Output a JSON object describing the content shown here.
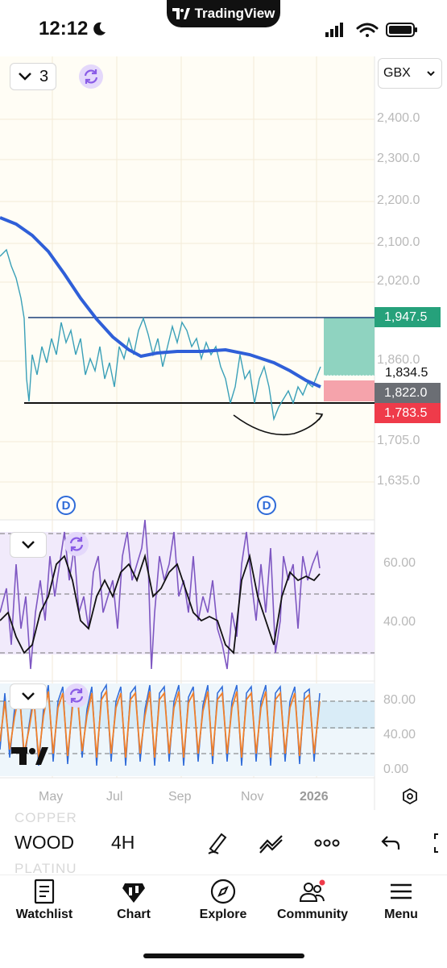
{
  "status_bar": {
    "time": "12:12",
    "app_pill": "TradingView"
  },
  "chart_toolbar": {
    "layout_count": "3",
    "currency": "GBX"
  },
  "price_axis": [
    "2,400.0",
    "2,300.0",
    "2,200.0",
    "2,100.0",
    "2,020.0",
    "1,860.0",
    "1,705.0",
    "1,635.0"
  ],
  "price_tags": {
    "target": {
      "value": "1,947.5",
      "color": "#26a17b"
    },
    "current": {
      "value": "1,834.5"
    },
    "last": {
      "value": "1,822.0",
      "color": "#6b6e74"
    },
    "stop": {
      "value": "1,783.5",
      "color": "#ef3b4a"
    }
  },
  "dividend_marker": "D",
  "rsi_axis": [
    "60.00",
    "40.00"
  ],
  "stoch_axis": [
    "80.00",
    "40.00",
    "0.00"
  ],
  "time_axis": [
    "May",
    "Jul",
    "Sep",
    "Nov",
    "2026"
  ],
  "symbol_bar": {
    "symbol": "WOOD",
    "interval": "4H",
    "ghost_above": "COPPER",
    "ghost_below": "PLATINU"
  },
  "nav": [
    {
      "label": "Watchlist",
      "icon": "watchlist-icon"
    },
    {
      "label": "Chart",
      "icon": "chart-icon"
    },
    {
      "label": "Explore",
      "icon": "compass-icon"
    },
    {
      "label": "Community",
      "icon": "community-icon"
    },
    {
      "label": "Menu",
      "icon": "menu-icon"
    }
  ],
  "colors": {
    "ma_line": "#2f5fd8",
    "price_line": "#3aa0b8",
    "rsi_line": "#7e57c2",
    "stoch_k": "#2f6bd8",
    "stoch_d": "#f07f2a"
  }
}
